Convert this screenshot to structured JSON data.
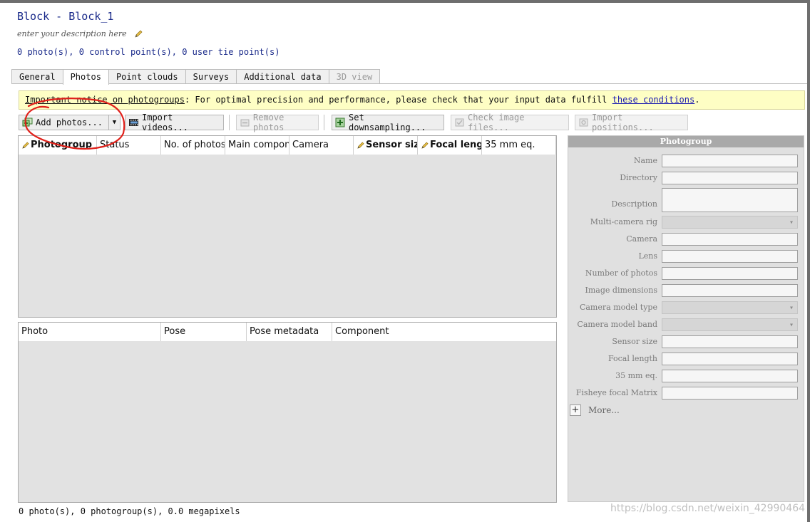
{
  "header": {
    "title": "Block - Block_1",
    "description_placeholder": "enter your description here",
    "counts": "0 photo(s), 0 control point(s), 0 user tie point(s)"
  },
  "tabs": [
    {
      "label": "General"
    },
    {
      "label": "Photos"
    },
    {
      "label": "Point clouds"
    },
    {
      "label": "Surveys"
    },
    {
      "label": "Additional data"
    },
    {
      "label": "3D view"
    }
  ],
  "notice": {
    "title": "Important notice on photogroups",
    "text": ": For optimal precision and performance, please check that your input data fulfill ",
    "link": "these conditions",
    "end": "."
  },
  "toolbar": {
    "add_photos": "Add photos...",
    "import_videos": "Import videos...",
    "remove_photos": "Remove photos",
    "set_downsampling": "Set downsampling...",
    "check_image_files": "Check image files...",
    "import_positions": "Import positions..."
  },
  "photogroup_table": {
    "columns": [
      "Photogroup",
      "Status",
      "No. of photos",
      "Main component",
      "Camera",
      "Sensor size",
      "Focal length",
      "35 mm eq."
    ]
  },
  "photo_table": {
    "columns": [
      "Photo",
      "Pose",
      "Pose metadata",
      "Component"
    ]
  },
  "panel": {
    "title": "Photogroup",
    "fields": [
      "Name",
      "Directory",
      "Description",
      "Multi-camera rig",
      "Camera",
      "Lens",
      "Number of photos",
      "Image dimensions",
      "Camera model type",
      "Camera model band",
      "Sensor size",
      "Focal length",
      "35 mm eq.",
      "Fisheye focal Matrix"
    ],
    "more": "More..."
  },
  "status": "0 photo(s), 0 photogroup(s), 0.0 megapixels",
  "watermark": "https://blog.csdn.net/weixin_42990464",
  "colors": {
    "title": "#1a2a8a",
    "notice_bg": "#fefec4",
    "link": "#1a1ab0",
    "annotation": "#e0201a"
  },
  "icons": [
    "pencil-icon",
    "add-photo-icon",
    "film-icon",
    "remove-photo-icon",
    "downsampling-icon",
    "check-files-icon",
    "import-positions-icon",
    "dropdown-arrow-icon",
    "plus-icon"
  ]
}
